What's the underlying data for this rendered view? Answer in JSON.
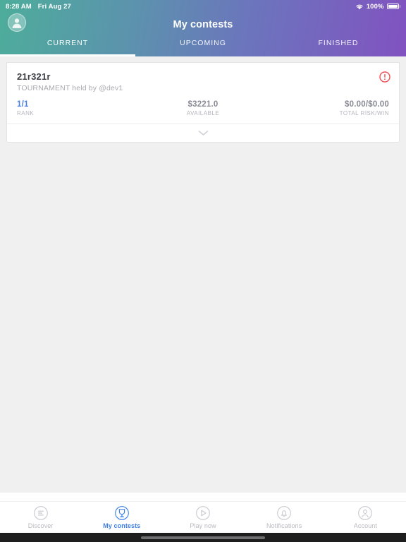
{
  "status_bar": {
    "time": "8:28 AM",
    "date": "Fri Aug 27",
    "battery_percent": "100%",
    "wifi_icon": "wifi-icon",
    "battery_icon": "battery-full-icon"
  },
  "header": {
    "title": "My contests",
    "avatar_icon": "user-avatar-icon",
    "gradient_start": "#4dad9b",
    "gradient_end": "#8152c0",
    "tabs": [
      {
        "label": "CURRENT",
        "active": true
      },
      {
        "label": "UPCOMING",
        "active": false
      },
      {
        "label": "FINISHED",
        "active": false
      }
    ]
  },
  "contest_card": {
    "name": "21r321r",
    "subtitle": "TOURNAMENT held by @dev1",
    "alert_icon": "alert-circle-icon",
    "alert_color": "#ef4f51",
    "expand_icon": "chevron-down-icon",
    "stats": [
      {
        "value": "1/1",
        "label": "RANK",
        "color": "#4a7fe0"
      },
      {
        "value": "$3221.0",
        "label": "AVAILABLE",
        "color": "#8a8a96"
      },
      {
        "value": "$0.00/$0.00",
        "label": "TOTAL RISK/WIN",
        "color": "#8a8a96"
      }
    ]
  },
  "tab_bar": {
    "active_color": "#3d7ee8",
    "inactive_color": "#b9b9c0",
    "items": [
      {
        "label": "Discover",
        "icon": "discover-icon",
        "active": false
      },
      {
        "label": "My contests",
        "icon": "trophy-icon",
        "active": true
      },
      {
        "label": "Play now",
        "icon": "play-circle-icon",
        "active": false
      },
      {
        "label": "Notifications",
        "icon": "bell-icon",
        "active": false
      },
      {
        "label": "Account",
        "icon": "account-icon",
        "active": false
      }
    ]
  }
}
